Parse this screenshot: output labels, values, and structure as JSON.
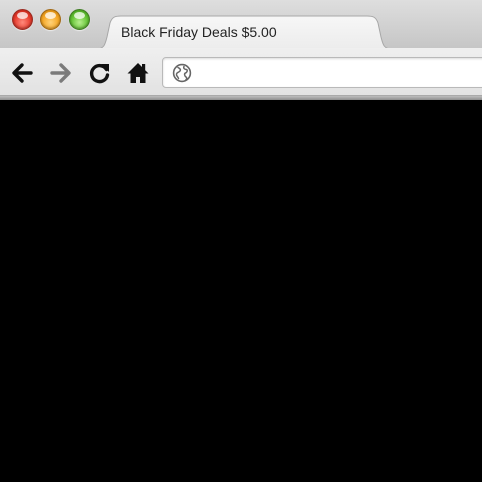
{
  "tab": {
    "title": "Black Friday Deals $5.00"
  },
  "toolbar": {
    "address_value": "",
    "icons": {
      "back": "back-arrow-icon",
      "forward": "forward-arrow-icon",
      "reload": "reload-icon",
      "home": "home-icon",
      "globe": "globe-icon"
    }
  },
  "colors": {
    "close": "#e63a2c",
    "minimize": "#f5a623",
    "maximize": "#62c233",
    "content_background": "#000000",
    "toolbar_background": "#e8e8e8"
  }
}
